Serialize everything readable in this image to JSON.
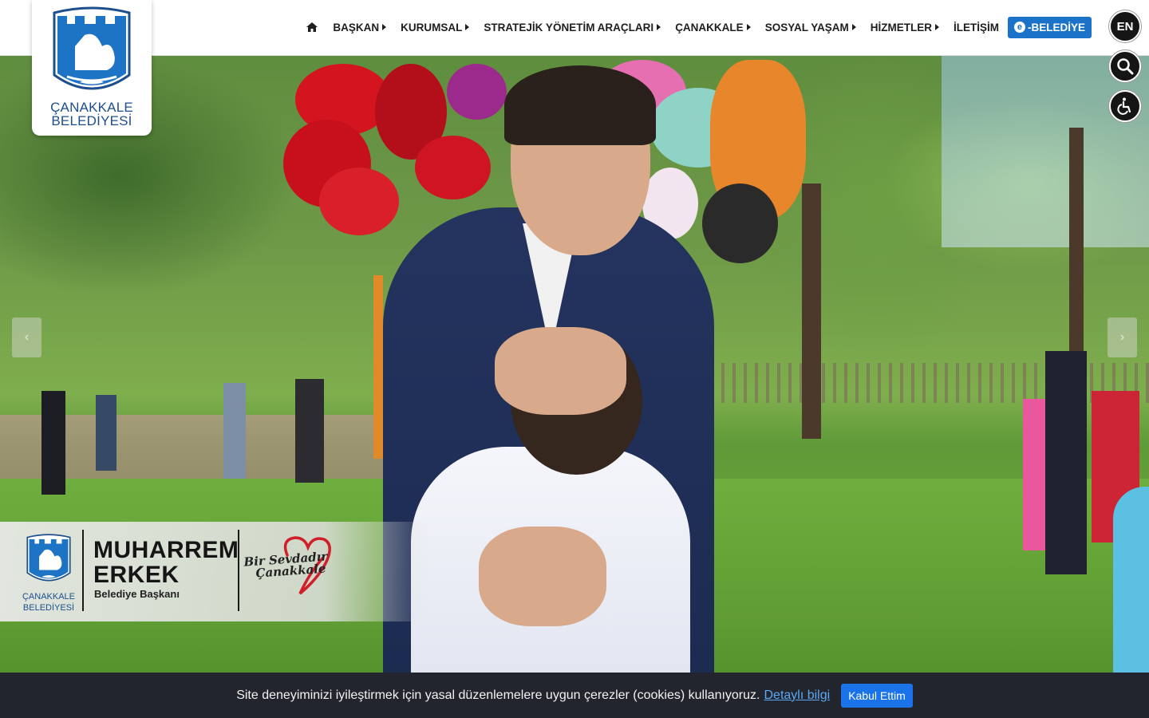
{
  "logo": {
    "line1": "ÇANAKKALE",
    "line2": "BELEDİYESİ"
  },
  "nav": {
    "items": [
      {
        "label": "BAŞKAN",
        "caret": true
      },
      {
        "label": "KURUMSAL",
        "caret": true
      },
      {
        "label": "STRATEJİK YÖNETİM ARAÇLARI",
        "caret": true
      },
      {
        "label": "ÇANAKKALE",
        "caret": true
      },
      {
        "label": "SOSYAL YAŞAM",
        "caret": true
      },
      {
        "label": "HİZMETLER",
        "caret": true
      },
      {
        "label": "İLETİŞİM",
        "caret": false
      }
    ],
    "ebelediye_label": "-BELEDİYE",
    "ebelediye_icon_letter": "e"
  },
  "side": {
    "language": "EN",
    "search_icon": "search-icon",
    "accessibility_icon": "accessibility-icon"
  },
  "slider": {
    "prev": "‹",
    "next": "›"
  },
  "banner": {
    "logo_line1": "ÇANAKKALE",
    "logo_line2": "BELEDİYESİ",
    "name_first": "MUHARREM",
    "name_last": "ERKEK",
    "title": "Belediye Başkanı",
    "slogan_line1": "Bir Sevdadır",
    "slogan_line2": "Çanakkale"
  },
  "cookie": {
    "text": "Site deneyiminizi iyileştirmek için yasal düzenlemelere uygun çerezler (cookies) kullanıyoruz.",
    "link": "Detaylı bilgi",
    "button": "Kabul Ettim"
  },
  "colors": {
    "brand_blue": "#1d4f8c",
    "accent": "#1a73c9",
    "cookie_bg": "#22252e"
  }
}
